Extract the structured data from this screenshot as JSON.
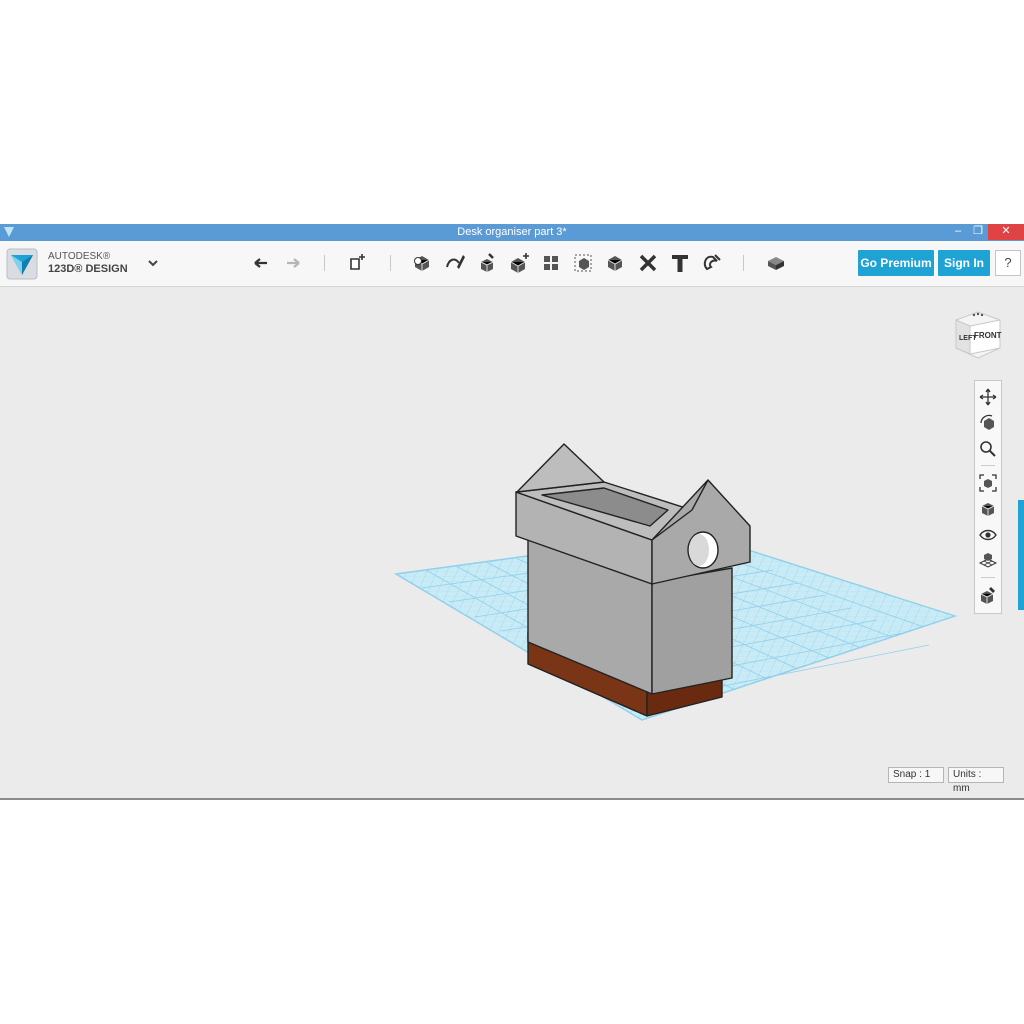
{
  "window": {
    "title": "Desk organiser part 3*",
    "controls": {
      "minimize": "–",
      "maximize": "❐",
      "close": "✕"
    }
  },
  "brand": {
    "line1": "AUTODESK®",
    "line2": "123D® DESIGN"
  },
  "toolbar": {
    "tools": [
      "undo-icon",
      "redo-icon",
      "transform-icon",
      "primitives-icon",
      "sketch-icon",
      "construct-icon",
      "modify-icon",
      "pattern-icon",
      "grouping-icon",
      "combine-icon",
      "measure-icon",
      "text-icon",
      "snap-icon",
      "material-icon"
    ],
    "go_premium_label": "Go Premium",
    "sign_in_label": "Sign In",
    "help_label": "?"
  },
  "viewcube": {
    "left_label": "LEFT",
    "front_label": "FRONT"
  },
  "navbar": {
    "tools": [
      "pan-icon",
      "orbit-icon",
      "zoom-icon",
      "fit-icon",
      "views-icon",
      "visibility-icon",
      "grid-icon",
      "material-view-icon"
    ]
  },
  "status": {
    "snap": "Snap : 1",
    "units": "Units : mm"
  },
  "colors": {
    "title_bar": "#5b9bd5",
    "accent": "#1fa3d5",
    "model_body": "#a9a9a9",
    "model_base": "#7a3416",
    "grid": "#8fd0ea"
  }
}
